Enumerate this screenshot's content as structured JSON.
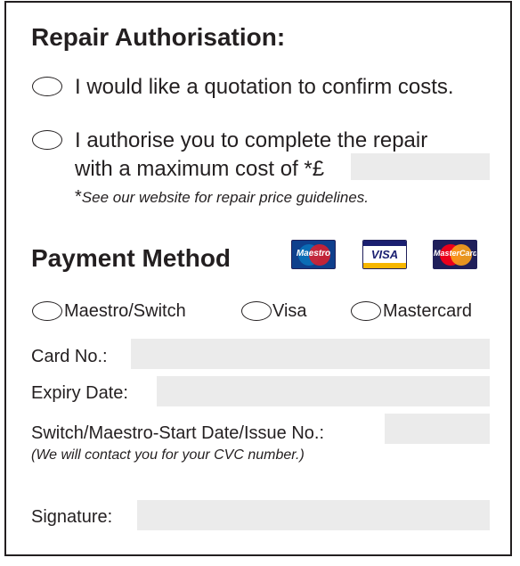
{
  "repair": {
    "title": "Repair Authorisation:",
    "option_quote": "I would like a quotation to confirm costs.",
    "option_authorise_line1": "I authorise you to complete the repair",
    "option_authorise_line2": "with a maximum cost of *£",
    "max_cost_value": "",
    "note_star": "*",
    "note_text": "See our website for repair price guidelines."
  },
  "payment": {
    "title": "Payment Method",
    "card_logos": [
      "Maestro",
      "VISA",
      "MasterCard"
    ],
    "methods": [
      "Maestro/Switch",
      "Visa",
      "Mastercard"
    ],
    "card_no_label": "Card No.:",
    "card_no_value": "",
    "expiry_label": "Expiry Date:",
    "expiry_value": "",
    "switch_label": "Switch/Maestro-Start Date/Issue No.:",
    "switch_value": "",
    "cvc_note": "(We will contact you for your CVC number.)",
    "signature_label": "Signature:",
    "signature_value": ""
  },
  "colors": {
    "text": "#231f20",
    "field_fill": "#ebebeb",
    "maestro_blue": "#0a6cb5",
    "maestro_red": "#d6202f",
    "visa_blue": "#1a1f71",
    "visa_gold": "#f7b600",
    "mastercard_red": "#eb001b",
    "mastercard_orange": "#f79e1b"
  }
}
